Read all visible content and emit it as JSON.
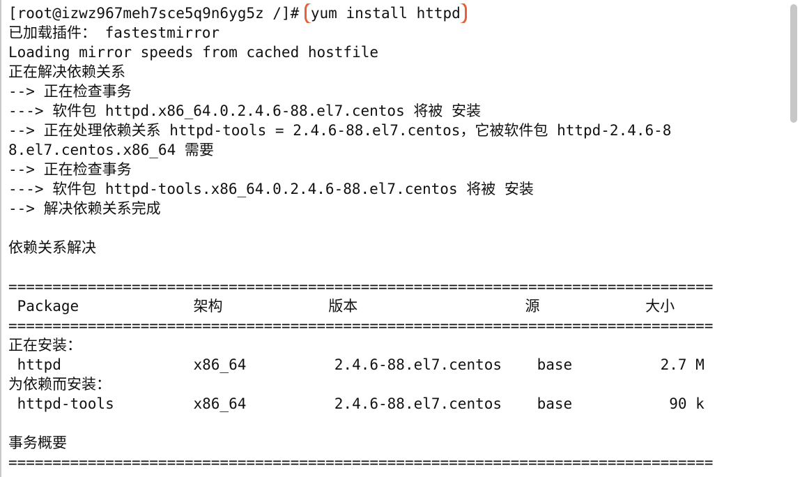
{
  "terminal": {
    "prompt": "[root@izwz967meh7sce5q9n6yg5z /]# ",
    "command": "yum install httpd",
    "lines": [
      "已加载插件： fastestmirror",
      "Loading mirror speeds from cached hostfile",
      "正在解决依赖关系",
      "--> 正在检查事务",
      "---> 软件包 httpd.x86_64.0.2.4.6-88.el7.centos 将被 安装",
      "--> 正在处理依赖关系 httpd-tools = 2.4.6-88.el7.centos，它被软件包 httpd-2.4.6-8",
      "8.el7.centos.x86_64 需要",
      "--> 正在检查事务",
      "---> 软件包 httpd-tools.x86_64.0.2.4.6-88.el7.centos 将被 安装",
      "--> 解决依赖关系完成",
      "",
      "依赖关系解决",
      "",
      "================================================================================",
      " Package             架构            版本                   源            大小",
      "================================================================================",
      "正在安装：",
      " httpd               x86_64          2.4.6-88.el7.centos    base          2.7 M",
      "为依赖而安装：",
      " httpd-tools         x86_64          2.4.6-88.el7.centos    base           90 k",
      "",
      "事务概要",
      "================================================================================"
    ]
  }
}
